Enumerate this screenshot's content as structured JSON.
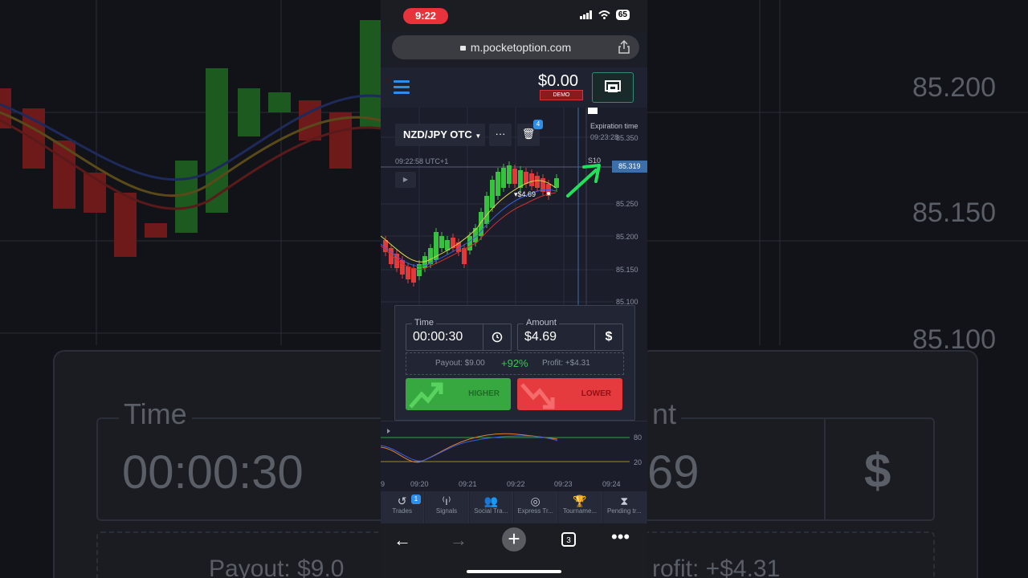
{
  "status_bar": {
    "time": "9:22",
    "battery": "65"
  },
  "browser": {
    "url": "m.pocketoption.com",
    "tab_count": "3"
  },
  "header": {
    "balance": "$0.00",
    "account_type": "DEMO"
  },
  "chart": {
    "asset": "NZD/JPY OTC",
    "trash_badge": "4",
    "timestamp": "09:22:58 UTC+1",
    "expiration_label": "Expiration time",
    "expiration_value": "09:23:28",
    "price_marker": "S10",
    "current_price": "85.319",
    "trade_marker": "▾$4.69",
    "price_labels": [
      "85.350",
      "85.250",
      "85.200",
      "85.150",
      "85.100"
    ],
    "time_labels": [
      "9",
      "09:20",
      "09:21",
      "09:22",
      "09:23",
      "09:24"
    ],
    "oscillator_levels": [
      "80",
      "20"
    ]
  },
  "trade_panel": {
    "time_label": "Time",
    "time_value": "00:00:30",
    "amount_label": "Amount",
    "amount_value": "$4.69",
    "currency_symbol": "$",
    "payout_text": "Payout: $9.00",
    "payout_pct": "+92%",
    "profit_text": "Profit: +$4.31",
    "higher_label": "HIGHER",
    "lower_label": "LOWER"
  },
  "bottom_tabs": [
    {
      "label": "Trades",
      "badge": "1",
      "icon": "history-icon"
    },
    {
      "label": "Signals",
      "icon": "signal-icon"
    },
    {
      "label": "Social Tra...",
      "icon": "users-icon"
    },
    {
      "label": "Express Tr...",
      "icon": "target-icon"
    },
    {
      "label": "Tourname...",
      "icon": "trophy-icon"
    },
    {
      "label": "Pending tr...",
      "icon": "hourglass-icon"
    }
  ],
  "background": {
    "right_prices": [
      "85.200",
      "85.150",
      "85.100"
    ],
    "left_time_label": "Time",
    "left_time_value": "00:00:30",
    "right_amount_partial": "nt",
    "right_value_partial": "69",
    "currency_symbol": "$",
    "payout_partial": "Payout: $9.0",
    "profit_partial": "rofit: +$4.31"
  },
  "colors": {
    "accent": "#2f8fe8",
    "green": "#36a83f",
    "red": "#e53b3e",
    "annotation_arrow": "#22e05a"
  }
}
